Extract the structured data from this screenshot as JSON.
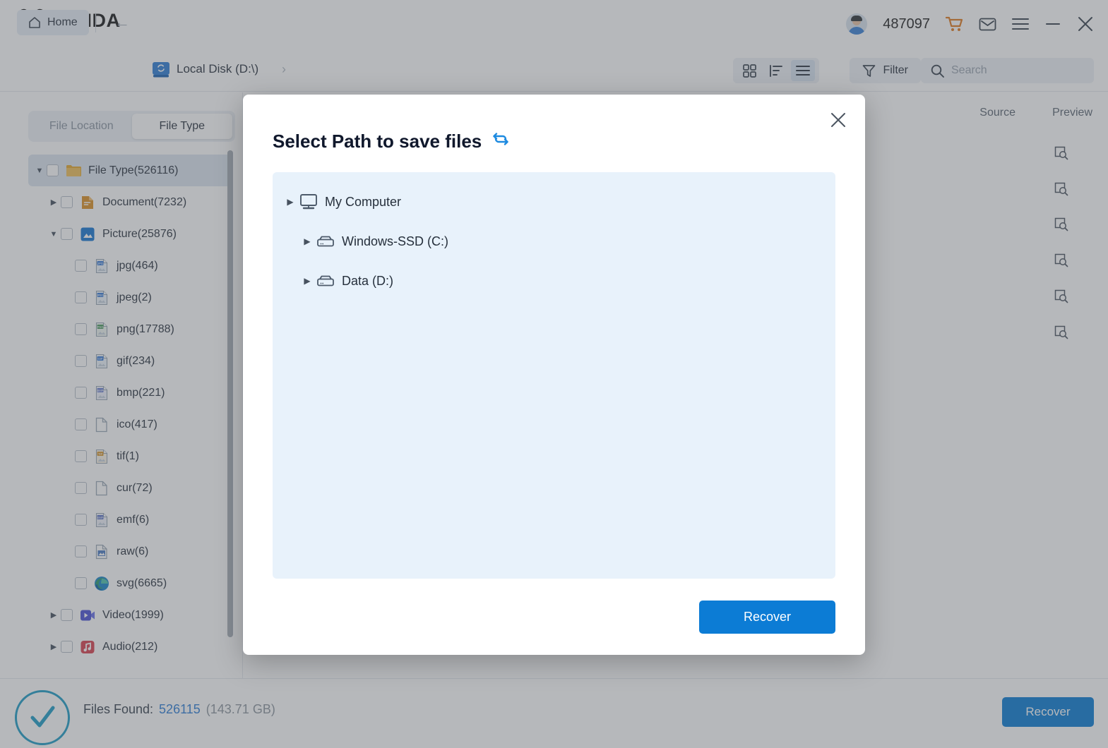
{
  "app": {
    "brand": "PANDA",
    "user_id": "487097"
  },
  "titlebar": {
    "cart_icon": "cart-icon",
    "mail_icon": "mail-icon",
    "menu_icon": "hamburger-menu-icon",
    "minimize_icon": "minimize-icon",
    "close_icon": "close-icon"
  },
  "toolbar": {
    "home_label": "Home",
    "back_icon": "back-arrow-icon",
    "breadcrumb": "Local Disk (D:\\)",
    "breadcrumb_chevron": "chevron-right-icon",
    "views": [
      {
        "name": "grid-view",
        "icon": "grid-icon",
        "active": false
      },
      {
        "name": "sort-view",
        "icon": "sort-icon",
        "active": false
      },
      {
        "name": "list-view",
        "icon": "list-icon",
        "active": true
      }
    ],
    "filter_label": "Filter",
    "search_placeholder": "Search",
    "search_value": ""
  },
  "sidebar": {
    "tabs": [
      {
        "label": "File Location",
        "active": false
      },
      {
        "label": "File Type",
        "active": true
      }
    ],
    "tree": [
      {
        "label": "File Type(526116)",
        "indent": 0,
        "caret": "down",
        "icon": "folder-icon",
        "selected": true
      },
      {
        "label": "Document(7232)",
        "indent": 1,
        "caret": "right",
        "icon": "document-icon",
        "selected": false
      },
      {
        "label": "Picture(25876)",
        "indent": 1,
        "caret": "down",
        "icon": "picture-icon",
        "selected": false
      },
      {
        "label": "jpg(464)",
        "indent": 2,
        "caret": "none",
        "icon": "jpg-file-icon",
        "selected": false
      },
      {
        "label": "jpeg(2)",
        "indent": 2,
        "caret": "none",
        "icon": "jpeg-file-icon",
        "selected": false
      },
      {
        "label": "png(17788)",
        "indent": 2,
        "caret": "none",
        "icon": "png-file-icon",
        "selected": false
      },
      {
        "label": "gif(234)",
        "indent": 2,
        "caret": "none",
        "icon": "gif-file-icon",
        "selected": false
      },
      {
        "label": "bmp(221)",
        "indent": 2,
        "caret": "none",
        "icon": "bmp-file-icon",
        "selected": false
      },
      {
        "label": "ico(417)",
        "indent": 2,
        "caret": "none",
        "icon": "blank-file-icon",
        "selected": false
      },
      {
        "label": "tif(1)",
        "indent": 2,
        "caret": "none",
        "icon": "tif-file-icon",
        "selected": false
      },
      {
        "label": "cur(72)",
        "indent": 2,
        "caret": "none",
        "icon": "blank-file-icon",
        "selected": false
      },
      {
        "label": "emf(6)",
        "indent": 2,
        "caret": "none",
        "icon": "emf-file-icon",
        "selected": false
      },
      {
        "label": "raw(6)",
        "indent": 2,
        "caret": "none",
        "icon": "raw-file-icon",
        "selected": false
      },
      {
        "label": "svg(6665)",
        "indent": 2,
        "caret": "none",
        "icon": "edge-browser-icon",
        "selected": false
      },
      {
        "label": "Video(1999)",
        "indent": 1,
        "caret": "right",
        "icon": "video-icon",
        "selected": false
      },
      {
        "label": "Audio(212)",
        "indent": 1,
        "caret": "right",
        "icon": "audio-icon",
        "selected": false
      }
    ]
  },
  "main": {
    "col_source": "Source",
    "col_preview": "Preview",
    "preview_icon_count": 6,
    "preview_icon_name": "preview-magnifier-icon"
  },
  "statusbar": {
    "status_icon": "success-check-icon",
    "files_found_label": "Files Found:",
    "files_found_count": "526115",
    "files_found_size": "(143.71 GB)",
    "recover_label": "Recover"
  },
  "modal": {
    "title": "Select Path to save files",
    "refresh_icon": "refresh-icon",
    "close_icon": "close-icon",
    "tree": [
      {
        "label": "My Computer",
        "indent": 0,
        "icon": "computer-icon"
      },
      {
        "label": "Windows-SSD (C:)",
        "indent": 1,
        "icon": "drive-icon"
      },
      {
        "label": "Data (D:)",
        "indent": 1,
        "icon": "drive-icon"
      }
    ],
    "recover_label": "Recover"
  },
  "colors": {
    "accent_blue": "#0c7cd5",
    "panel_blue": "#e8f2fb",
    "link_blue": "#2f7fd6",
    "check_teal": "#1f9dc6",
    "cart_orange": "#e07b1f"
  }
}
